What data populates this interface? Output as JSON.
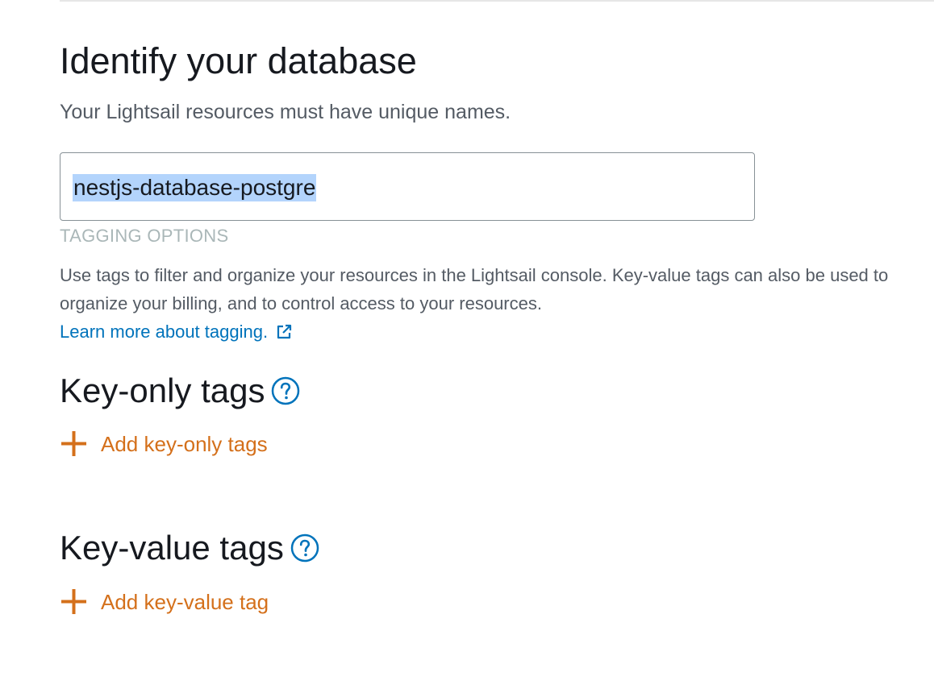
{
  "identify": {
    "title": "Identify your database",
    "subtitle": "Your Lightsail resources must have unique names.",
    "name_value": "nestjs-database-postgre"
  },
  "tagging": {
    "heading": "TAGGING OPTIONS",
    "description": "Use tags to filter and organize your resources in the Lightsail console. Key-value tags can also be used to organize your billing, and to control access to your resources.",
    "learn_more": "Learn more about tagging."
  },
  "key_only": {
    "heading": "Key-only tags",
    "add_label": "Add key-only tags"
  },
  "key_value": {
    "heading": "Key-value tags",
    "add_label": "Add key-value tag"
  },
  "icons": {
    "help": "help-circle-icon",
    "external": "external-link-icon",
    "add": "plus-icon"
  },
  "colors": {
    "accent_orange": "#d4701b",
    "link_blue": "#0073bb",
    "selection": "#b3d4fc"
  }
}
